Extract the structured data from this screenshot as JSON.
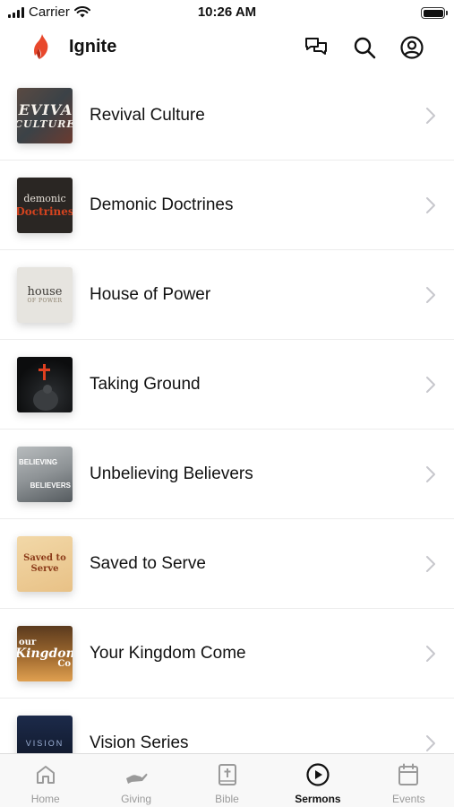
{
  "status_bar": {
    "carrier": "Carrier",
    "time": "10:26 AM"
  },
  "header": {
    "title": "Ignite",
    "brand_color": "#e8482c"
  },
  "sermons": [
    {
      "title": "Revival Culture",
      "thumb_text": [
        "REVIVAL",
        "CULTURE"
      ]
    },
    {
      "title": "Demonic Doctrines",
      "thumb_text": [
        "demonic",
        "Doctrines"
      ]
    },
    {
      "title": "House of Power",
      "thumb_text": [
        "house",
        "OF POWER"
      ]
    },
    {
      "title": "Taking Ground",
      "thumb_text": []
    },
    {
      "title": "Unbelieving Believers",
      "thumb_text": [
        "BELIEVING",
        "BELIEVERS"
      ]
    },
    {
      "title": "Saved to Serve",
      "thumb_text": [
        "Saved to",
        "Serve"
      ]
    },
    {
      "title": "Your Kingdom Come",
      "thumb_text": [
        "our",
        "Kingdom",
        "Co"
      ]
    },
    {
      "title": "Vision Series",
      "thumb_text": [
        "VISION"
      ]
    }
  ],
  "tabs": [
    {
      "label": "Home",
      "icon": "home-icon",
      "active": false
    },
    {
      "label": "Giving",
      "icon": "giving-icon",
      "active": false
    },
    {
      "label": "Bible",
      "icon": "bible-icon",
      "active": false
    },
    {
      "label": "Sermons",
      "icon": "play-circle-icon",
      "active": true
    },
    {
      "label": "Events",
      "icon": "calendar-icon",
      "active": false
    }
  ]
}
